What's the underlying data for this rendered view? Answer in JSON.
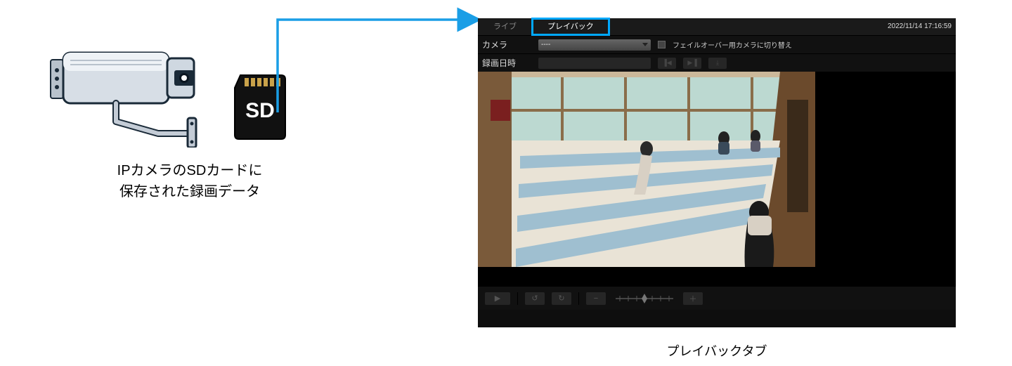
{
  "left": {
    "caption_line1": "IPカメラのSDカードに",
    "caption_line2": "保存された録画データ",
    "sd_label": "SD"
  },
  "panel": {
    "tabs": {
      "live": "ライブ",
      "playback": "プレイバック"
    },
    "timestamp": "2022/11/14 17:16:59",
    "row_camera": {
      "label": "カメラ",
      "selected": "----",
      "failover_label": "フェイルオーバー用カメラに切り替え"
    },
    "row_datetime": {
      "label": "録画日時"
    },
    "icons": {
      "prev": "▐◀",
      "next": "▶▐",
      "dl": "⤓"
    },
    "controls": {
      "play": "▶",
      "back": "↺",
      "fwd": "↻",
      "minus": "−",
      "plus": "＋"
    }
  },
  "panel_caption": "プレイバックタブ",
  "colors": {
    "highlight": "#00a8ff",
    "arrow": "#1a9ee6"
  }
}
